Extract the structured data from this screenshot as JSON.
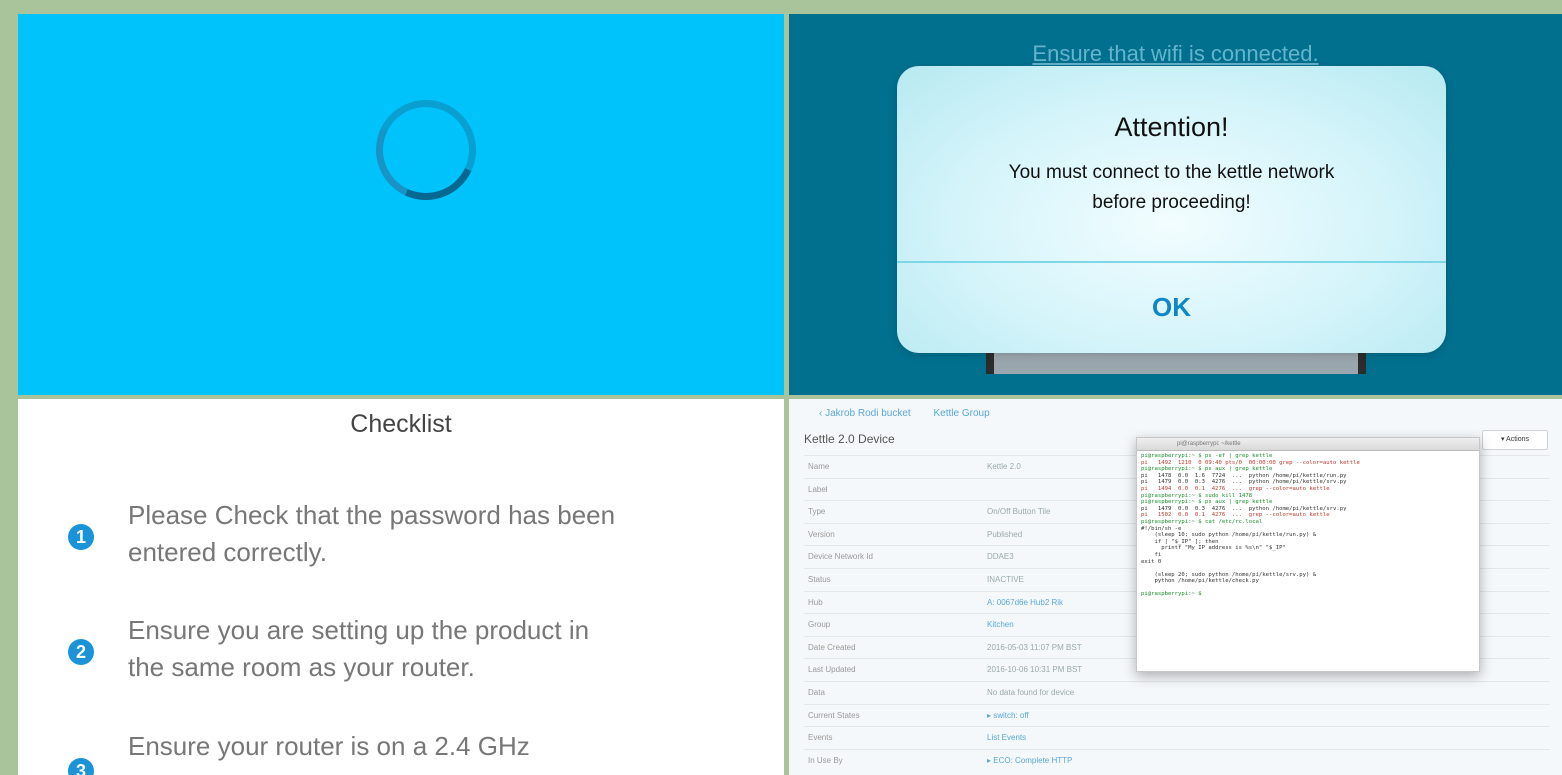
{
  "loading_panel": {
    "spinner": "loading-spinner"
  },
  "alert_panel": {
    "heading": "Ensure that wifi is connected.",
    "dialog": {
      "title": "Attention!",
      "message_lines": [
        "You must connect to the kettle network",
        "before proceeding!"
      ],
      "ok_label": "OK"
    }
  },
  "checklist": {
    "title": "Checklist",
    "items": [
      {
        "num": "1",
        "lines": [
          "Please Check that the password has been",
          "entered correctly."
        ]
      },
      {
        "num": "2",
        "lines": [
          "Ensure you are setting up the product in",
          "the same room as your router."
        ]
      },
      {
        "num": "3",
        "lines": [
          "Ensure your router is on a 2.4 GHz"
        ]
      }
    ]
  },
  "admin": {
    "breadcrumb": [
      "‹ Jakrob Rodi bucket",
      "Kettle Group"
    ],
    "title": "Kettle 2.0 Device",
    "action_button": "▾ Actions",
    "rows": [
      {
        "k": "Name",
        "v": "Kettle 2.0",
        "link": false
      },
      {
        "k": "Label",
        "v": "",
        "link": false
      },
      {
        "k": "Type",
        "v": "On/Off Button Tile",
        "link": false
      },
      {
        "k": "Version",
        "v": "Published",
        "link": false
      },
      {
        "k": "Device Network Id",
        "v": "DDAE3",
        "link": false
      },
      {
        "k": "Status",
        "v": "INACTIVE",
        "link": false
      },
      {
        "k": "Hub",
        "v": "A: 0067d6e Hub2 Rik",
        "link": true
      },
      {
        "k": "Group",
        "v": "Kitchen",
        "link": true
      },
      {
        "k": "Date Created",
        "v": "2016-05-03 11:07 PM BST",
        "link": false
      },
      {
        "k": "Last Updated",
        "v": "2016-10-06 10:31 PM BST",
        "link": false
      },
      {
        "k": "Data",
        "v": "No data found for device",
        "link": false
      },
      {
        "k": "Current States",
        "v": "▸ switch: off",
        "link": true
      },
      {
        "k": "Events",
        "v": "List Events",
        "link": true
      },
      {
        "k": "In Use By",
        "v": "▸ ECO: Complete HTTP",
        "link": true
      }
    ],
    "terminal": {
      "window_title": "pi@raspberrypi: ~/kettle",
      "lines": [
        {
          "t": "pi@raspberrypi:~ $ ps -ef | grep kettle",
          "c": "g"
        },
        {
          "t": "pi   1492  1210  0 09:40 pts/0  00:00:00 grep --color=auto kettle",
          "c": "r"
        },
        {
          "t": "pi@raspberrypi:~ $ ps aux | grep kettle",
          "c": "g"
        },
        {
          "t": "pi   1478  0.0  1.6  7724  ...  python /home/pi/kettle/run.py",
          "c": ""
        },
        {
          "t": "pi   1479  0.0  0.3  4276  ...  python /home/pi/kettle/srv.py",
          "c": ""
        },
        {
          "t": "pi   1494  0.0  0.1  4276  ...  grep --color=auto kettle",
          "c": "r"
        },
        {
          "t": "pi@raspberrypi:~ $ sudo kill 1478",
          "c": "g"
        },
        {
          "t": "pi@raspberrypi:~ $ ps aux | grep kettle",
          "c": "g"
        },
        {
          "t": "pi   1479  0.0  0.3  4276  ...  python /home/pi/kettle/srv.py",
          "c": ""
        },
        {
          "t": "pi   1502  0.0  0.1  4276  ...  grep --color=auto kettle",
          "c": "r"
        },
        {
          "t": "pi@raspberrypi:~ $ cat /etc/rc.local",
          "c": "g"
        },
        {
          "t": "#!/bin/sh -e",
          "c": ""
        },
        {
          "t": "    (sleep 10; sudo python /home/pi/kettle/run.py) &",
          "c": ""
        },
        {
          "t": "    if [ \"$_IP\" ]; then",
          "c": ""
        },
        {
          "t": "      printf \"My IP address is %s\\n\" \"$_IP\"",
          "c": ""
        },
        {
          "t": "    fi",
          "c": ""
        },
        {
          "t": "exit 0",
          "c": ""
        },
        {
          "t": "",
          "c": ""
        },
        {
          "t": "    (sleep 20; sudo python /home/pi/kettle/srv.py) &",
          "c": ""
        },
        {
          "t": "    python /home/pi/kettle/check.py",
          "c": ""
        },
        {
          "t": "",
          "c": ""
        },
        {
          "t": "pi@raspberrypi:~ $ ",
          "c": "g"
        }
      ]
    }
  },
  "colors": {
    "cyan": "#00c3fb",
    "teal": "#00708e",
    "accent": "#1b93d8",
    "ok": "#0d87c8"
  }
}
